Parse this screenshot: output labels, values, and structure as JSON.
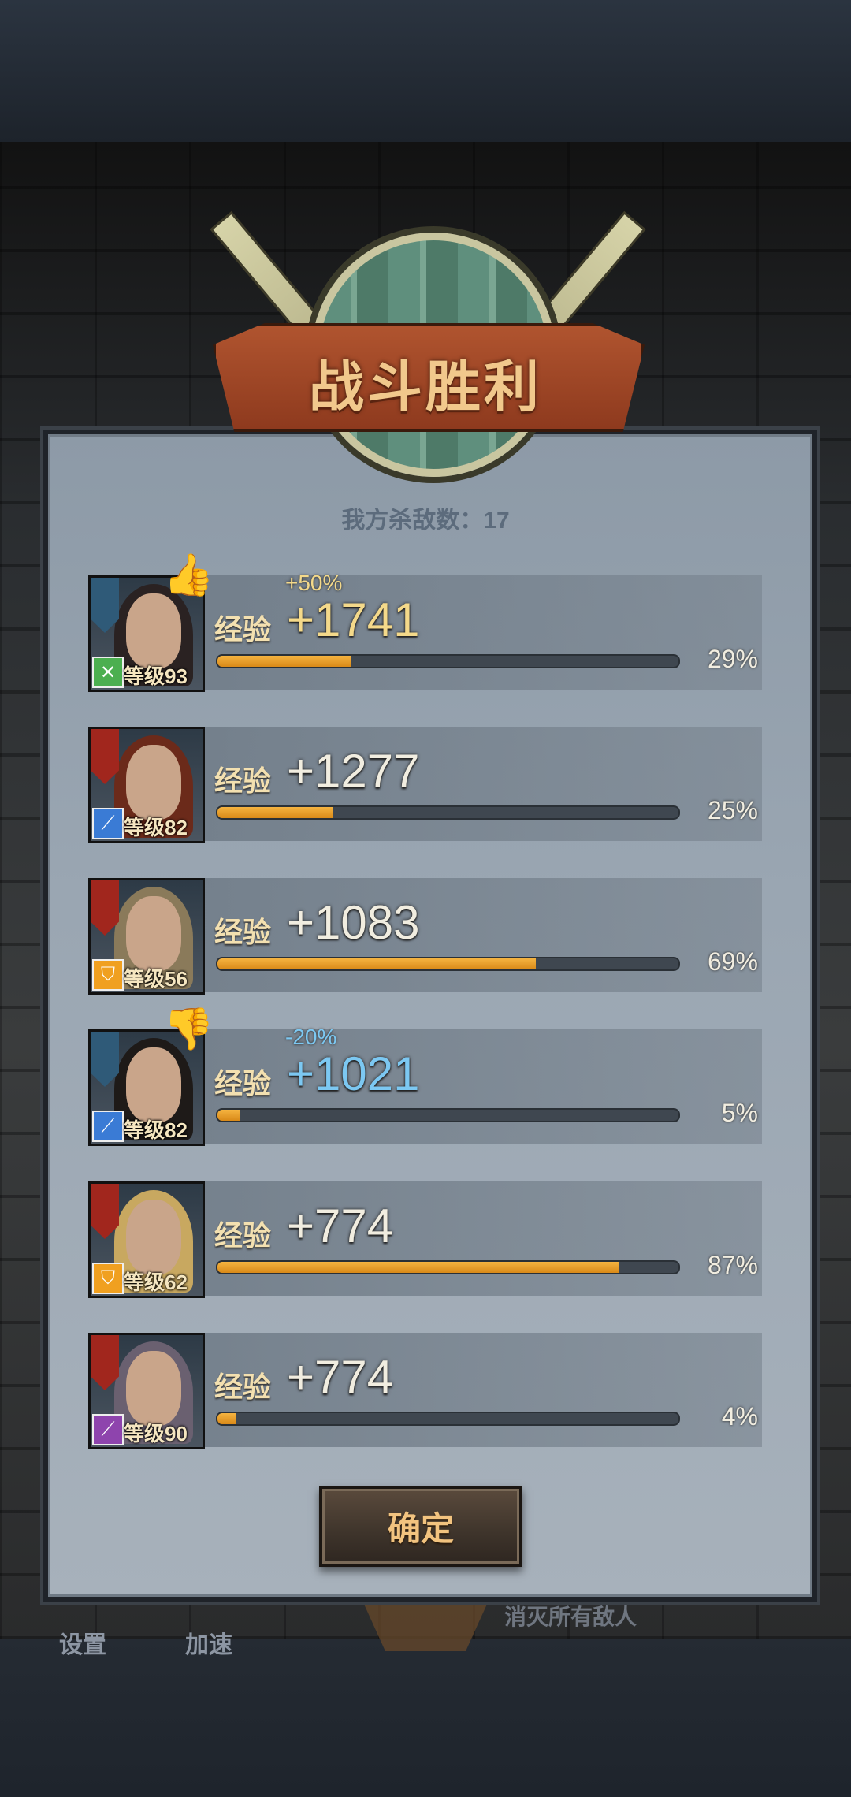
{
  "header": {
    "title": "战斗胜利"
  },
  "kills_text": "我方杀敌数：17",
  "heroes": [
    {
      "level_text": "等级93",
      "exp_label": "经验",
      "exp_value": "+1741",
      "bonus": "+50%",
      "percent": "29%",
      "progress": 29,
      "highlight": "gold",
      "faction_color": "#2f5a78",
      "class_icon": "crossed-swords",
      "class_color": "#4caf50",
      "badge": "thumbs-up"
    },
    {
      "level_text": "等级82",
      "exp_label": "经验",
      "exp_value": "+1277",
      "bonus": "",
      "percent": "25%",
      "progress": 25,
      "highlight": "normal",
      "faction_color": "#a1261d",
      "class_icon": "sword",
      "class_color": "#3a7bd5",
      "badge": ""
    },
    {
      "level_text": "等级56",
      "exp_label": "经验",
      "exp_value": "+1083",
      "bonus": "",
      "percent": "69%",
      "progress": 69,
      "highlight": "normal",
      "faction_color": "#a1261d",
      "class_icon": "shield",
      "class_color": "#f0a020",
      "badge": ""
    },
    {
      "level_text": "等级82",
      "exp_label": "经验",
      "exp_value": "+1021",
      "bonus": "-20%",
      "percent": "5%",
      "progress": 5,
      "highlight": "blue",
      "faction_color": "#2f5a78",
      "class_icon": "sword",
      "class_color": "#3a7bd5",
      "badge": "thumbs-down"
    },
    {
      "level_text": "等级62",
      "exp_label": "经验",
      "exp_value": "+774",
      "bonus": "",
      "percent": "87%",
      "progress": 87,
      "highlight": "normal",
      "faction_color": "#a1261d",
      "class_icon": "shield",
      "class_color": "#f0a020",
      "badge": ""
    },
    {
      "level_text": "等级90",
      "exp_label": "经验",
      "exp_value": "+774",
      "bonus": "",
      "percent": "4%",
      "progress": 4,
      "highlight": "normal",
      "faction_color": "#a1261d",
      "class_icon": "staff",
      "class_color": "#8e44ad",
      "badge": ""
    }
  ],
  "confirm_label": "确定",
  "bottom_nav": {
    "settings": "设置",
    "speed": "加速",
    "kill_all": "消灭所有敌人"
  }
}
